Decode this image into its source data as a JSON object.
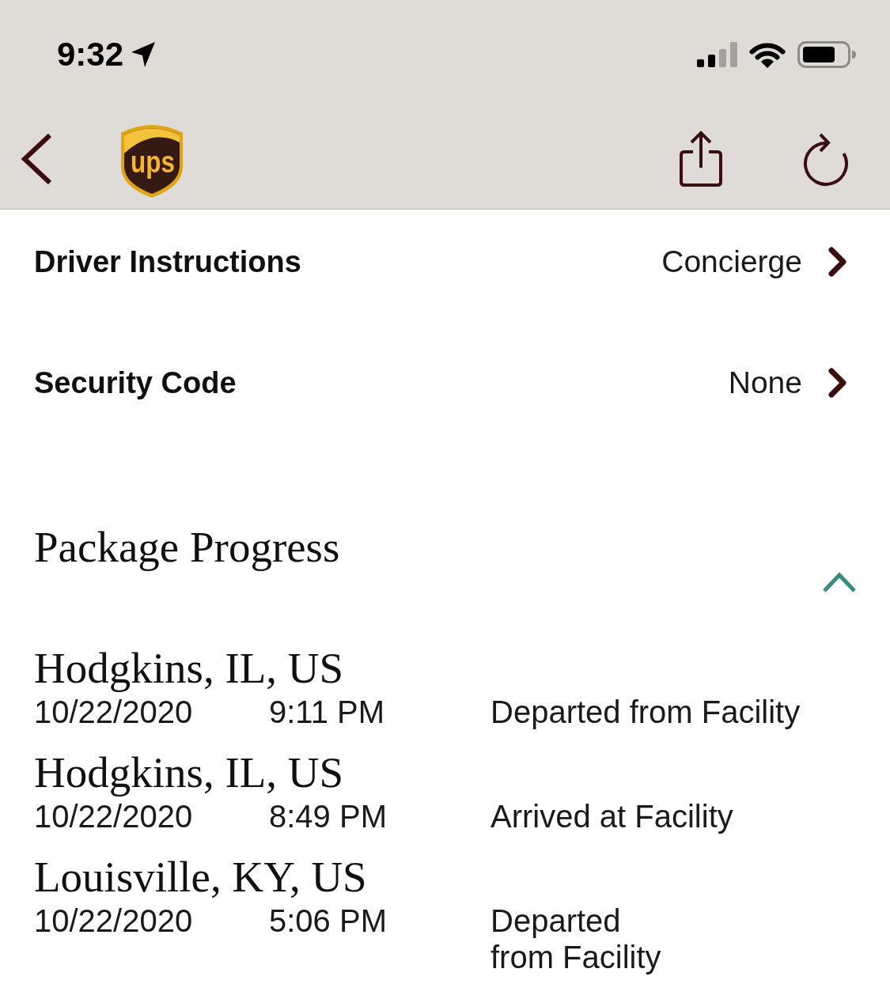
{
  "status_bar": {
    "time": "9:32"
  },
  "nav_bar": {
    "logo_text": "ups"
  },
  "details": [
    {
      "label": "Driver Instructions",
      "value": "Concierge"
    },
    {
      "label": "Security Code",
      "value": "None"
    }
  ],
  "package_progress": {
    "title": "Package Progress",
    "expanded": true,
    "events": [
      {
        "location": "Hodgkins, IL, US",
        "date": "10/22/2020",
        "time": "9:11 PM",
        "status": "Departed from Facility"
      },
      {
        "location": "Hodgkins, IL, US",
        "date": "10/22/2020",
        "time": "8:49 PM",
        "status": "Arrived at Facility"
      },
      {
        "location": "Louisville, KY, US",
        "date": "10/22/2020",
        "time": "5:06 PM",
        "status": "Departed\nfrom Facility"
      }
    ]
  }
}
